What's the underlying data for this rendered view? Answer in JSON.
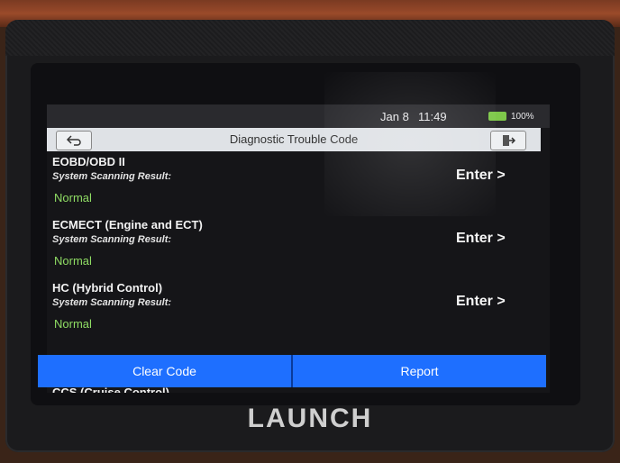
{
  "status_bar": {
    "date": "Jan 8",
    "time": "11:49",
    "battery_level": "100%",
    "battery_color": "#7ec84a"
  },
  "header": {
    "title": "Diagnostic Trouble Code",
    "back_icon": "back-arrow-icon",
    "exit_icon": "exit-icon"
  },
  "systems": [
    {
      "name": "EOBD/OBD II",
      "subtitle": "System Scanning Result:",
      "status": "Normal",
      "action": "Enter >"
    },
    {
      "name": "ECMECT (Engine and ECT)",
      "subtitle": "System Scanning Result:",
      "status": "Normal",
      "action": "Enter >"
    },
    {
      "name": "HC (Hybrid Control)",
      "subtitle": "System Scanning Result:",
      "status": "Normal",
      "action": "Enter >"
    }
  ],
  "partial_item": {
    "name": "CCS (Cruise Control)"
  },
  "footer": {
    "clear_code_label": "Clear Code",
    "report_label": "Report",
    "accent_color": "#1e6fff"
  },
  "device": {
    "brand": "LAUNCH"
  },
  "colors": {
    "status_normal": "#8fdc64",
    "title_bar_bg": "#dfe2e6"
  }
}
